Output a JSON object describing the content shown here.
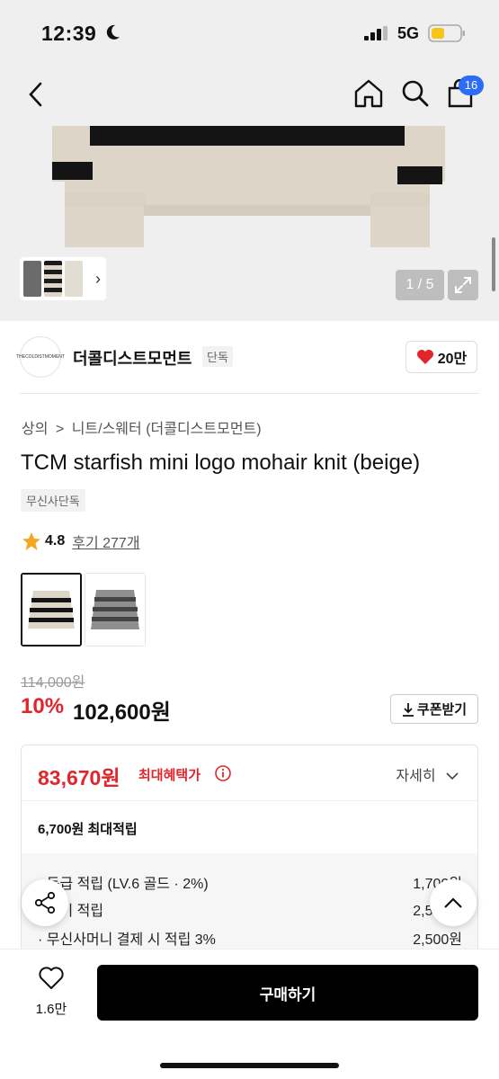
{
  "status_bar": {
    "time": "12:39",
    "network": "5G"
  },
  "nav": {
    "cart_count": "16"
  },
  "gallery": {
    "counter": "1 / 5"
  },
  "brand": {
    "logo_text": "THECOLDISTMOMENT",
    "name": "더콜디스트모먼트",
    "tag": "단독",
    "likes": "20만"
  },
  "breadcrumb": [
    "상의",
    ">",
    "니트/스웨터 (더콜디스트모먼트)"
  ],
  "product": {
    "title": "TCM starfish mini logo mohair knit (beige)",
    "exclusive_tag": "무신사단독",
    "rating": "4.8",
    "reviews": "후기 277개"
  },
  "price": {
    "original": "114,000원",
    "discount": "10%",
    "current": "102,600원",
    "coupon_label": "쿠폰받기"
  },
  "benefit": {
    "max_price": "83,670원",
    "max_label": "최대혜택가",
    "detail_label": "자세히",
    "points_label": "6,700원 최대적립",
    "rows": [
      {
        "label": "· 등급 적립 (LV.6 골드 · 2%)",
        "value": "1,700원"
      },
      {
        "label": "· 후기 적립",
        "value": "2,500원"
      },
      {
        "label": "· 무신사머니 결제 시 적립 3%",
        "value": "2,500원"
      }
    ]
  },
  "bottom": {
    "wish_count": "1.6만",
    "buy_label": "구매하기"
  },
  "colors": {
    "accent_red": "#e3242b",
    "badge_blue": "#2c6cf6",
    "star": "#f5a623"
  }
}
